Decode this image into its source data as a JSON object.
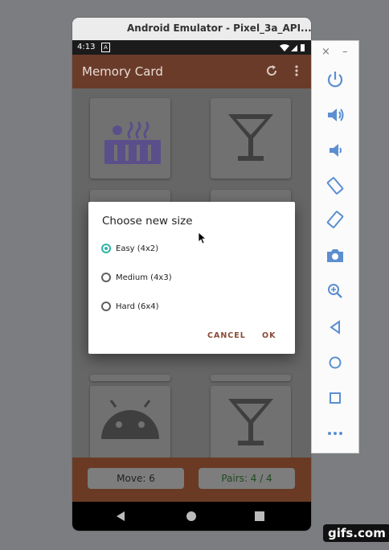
{
  "emulator": {
    "title": "Android Emulator - Pixel_3a_API...",
    "status_time": "4:13",
    "status_badge": "A"
  },
  "app": {
    "title": "Memory Card",
    "refresh_icon": "refresh-icon",
    "more_icon": "more-vert-icon",
    "colors": {
      "appbar": "#6b3b2a",
      "footer": "#6a3a24",
      "accent": "#2fb3a6",
      "dialog_button": "#8a4a36"
    }
  },
  "cards": [
    {
      "icon": "factory-icon"
    },
    {
      "icon": "cocktail-glass-icon"
    },
    {
      "icon": "android-icon"
    },
    {
      "icon": "cocktail-glass-icon"
    }
  ],
  "footer": {
    "moves": "Move: 6",
    "pairs": "Pairs: 4 / 4"
  },
  "dialog": {
    "title": "Choose new size",
    "options": [
      {
        "label": "Easy (4x2)",
        "selected": true
      },
      {
        "label": "Medium (4x3)",
        "selected": false
      },
      {
        "label": "Hard (6x4)",
        "selected": false
      }
    ],
    "cancel_label": "CANCEL",
    "ok_label": "OK"
  },
  "toolbar": {
    "close_label": "×",
    "minimize_label": "–",
    "tools": [
      "power-icon",
      "volume-up-icon",
      "volume-down-icon",
      "rotate-left-icon",
      "rotate-right-icon",
      "camera-icon",
      "zoom-icon",
      "back-icon",
      "home-icon",
      "overview-icon",
      "more-icon"
    ]
  },
  "watermark": "gifs.com"
}
